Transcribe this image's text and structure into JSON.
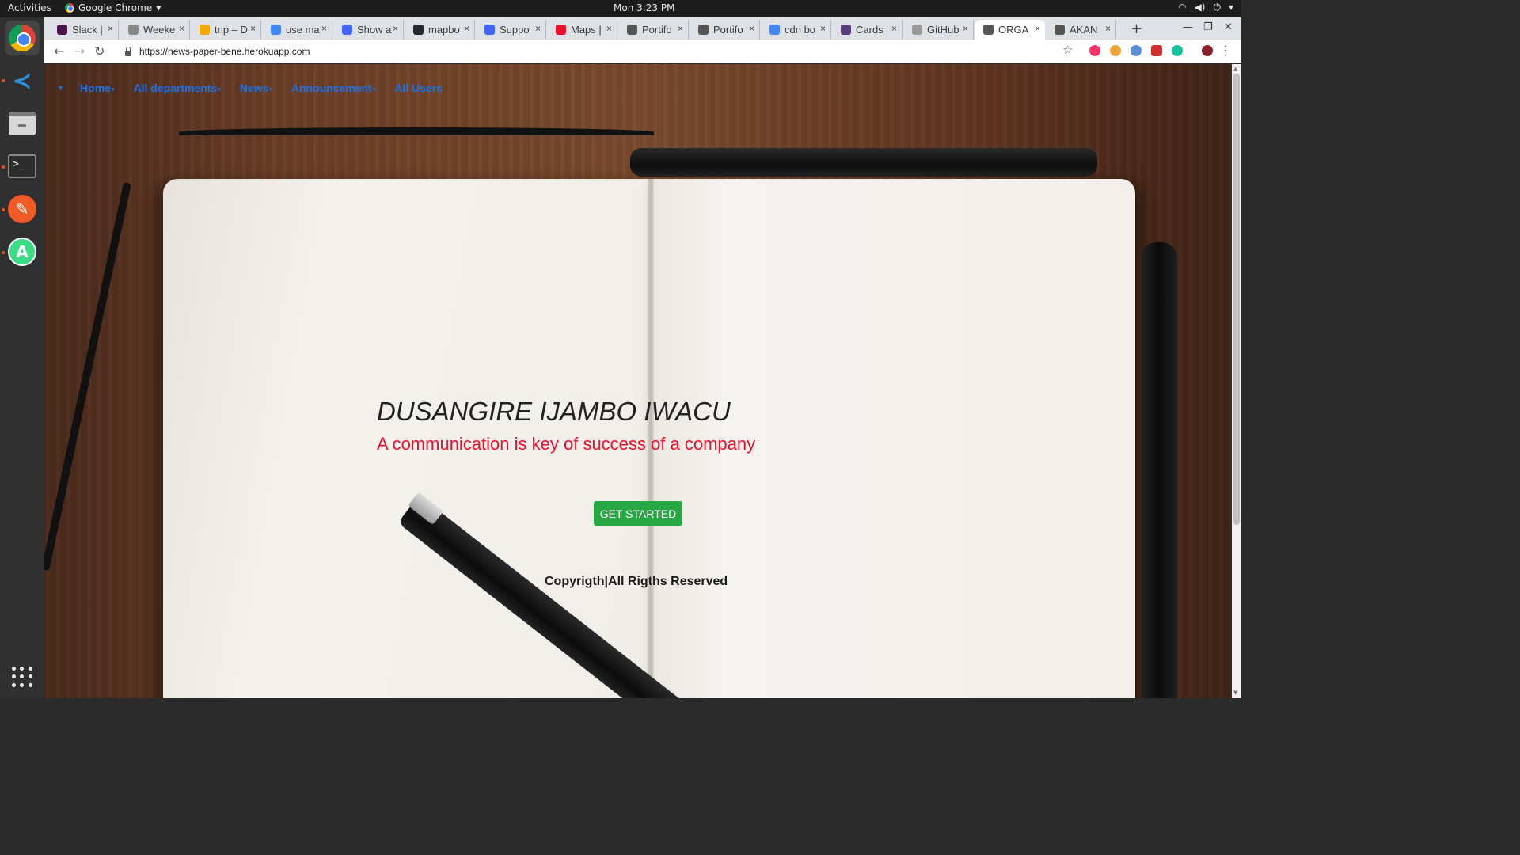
{
  "os": {
    "activities": "Activities",
    "app_menu": "Google Chrome",
    "clock": "Mon  3:23 PM"
  },
  "dock": [
    "Google Chrome",
    "Visual Studio Code",
    "Files",
    "Terminal",
    "Postman",
    "Android Studio"
  ],
  "tabs": [
    {
      "title": "Slack |",
      "icon": "slack-icon",
      "color": "#4a154b"
    },
    {
      "title": "Weeke",
      "icon": "pin-icon",
      "color": "#888888"
    },
    {
      "title": "trip – D",
      "icon": "hand-icon",
      "color": "#f2a900"
    },
    {
      "title": "use ma",
      "icon": "google-icon",
      "color": "#4285f4"
    },
    {
      "title": "Show a",
      "icon": "mapbox-icon",
      "color": "#4264fb"
    },
    {
      "title": "mapbo",
      "icon": "github-icon",
      "color": "#24292e"
    },
    {
      "title": "Suppo",
      "icon": "mapbox-icon",
      "color": "#4264fb"
    },
    {
      "title": "Maps |",
      "icon": "maps-icon",
      "color": "#e8102a"
    },
    {
      "title": "Portifo",
      "icon": "globe-icon",
      "color": "#555555"
    },
    {
      "title": "Portifo",
      "icon": "globe-icon",
      "color": "#555555"
    },
    {
      "title": "cdn bo",
      "icon": "google-icon",
      "color": "#4285f4"
    },
    {
      "title": "Cards",
      "icon": "bootstrap-icon",
      "color": "#563d7c"
    },
    {
      "title": "GitHub",
      "icon": "loading-icon",
      "color": "#999999"
    },
    {
      "title": "ORGA",
      "icon": "globe-icon",
      "color": "#555555",
      "active": true
    },
    {
      "title": "AKAN",
      "icon": "globe-icon",
      "color": "#555555"
    }
  ],
  "url": "https://news-paper-bene.herokuapp.com",
  "nav": {
    "items": [
      {
        "label": "Home",
        "dropdown": true
      },
      {
        "label": "All departments",
        "dropdown": true
      },
      {
        "label": "News",
        "dropdown": true
      },
      {
        "label": "Announcement",
        "dropdown": true
      },
      {
        "label": "All Users",
        "dropdown": false
      }
    ]
  },
  "hero": {
    "title": "DUSANGIRE IJAMBO IWACU",
    "subtitle": "A communication is key of success of a company",
    "cta": "GET STARTED"
  },
  "footer": {
    "text": "Copyrigth|All Rigths Reserved"
  },
  "colors": {
    "nav_link": "#1a73e8",
    "subtitle": "#e8102a",
    "cta_bg": "#28a745"
  }
}
